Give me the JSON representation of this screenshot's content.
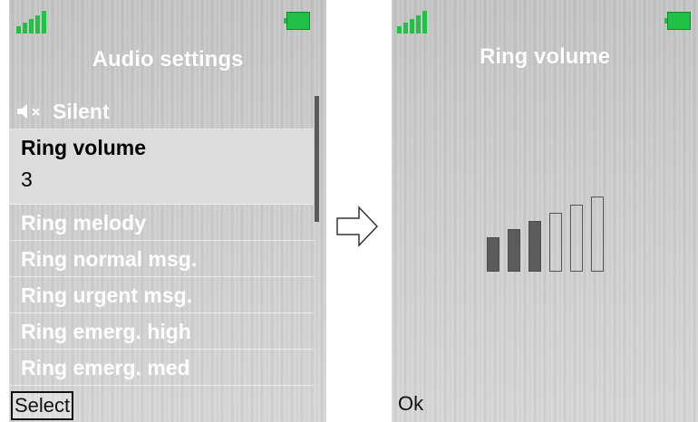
{
  "left_screen": {
    "title": "Audio settings",
    "items": [
      {
        "label": "Silent",
        "icon": "speaker-mute-icon"
      },
      {
        "label": "Ring volume",
        "value": "3",
        "selected": true
      },
      {
        "label": "Ring melody"
      },
      {
        "label": "Ring normal msg."
      },
      {
        "label": "Ring urgent msg."
      },
      {
        "label": "Ring emerg. high"
      },
      {
        "label": "Ring emerg. med"
      }
    ],
    "softkey": "Select"
  },
  "right_screen": {
    "title": "Ring volume",
    "volume_level": 3,
    "volume_max": 6,
    "softkey": "Ok"
  },
  "colors": {
    "signal": "#21c046",
    "battery": "#21c046",
    "selected_row": "#dcdcdc",
    "volume_filled": "#5c5c5c"
  }
}
